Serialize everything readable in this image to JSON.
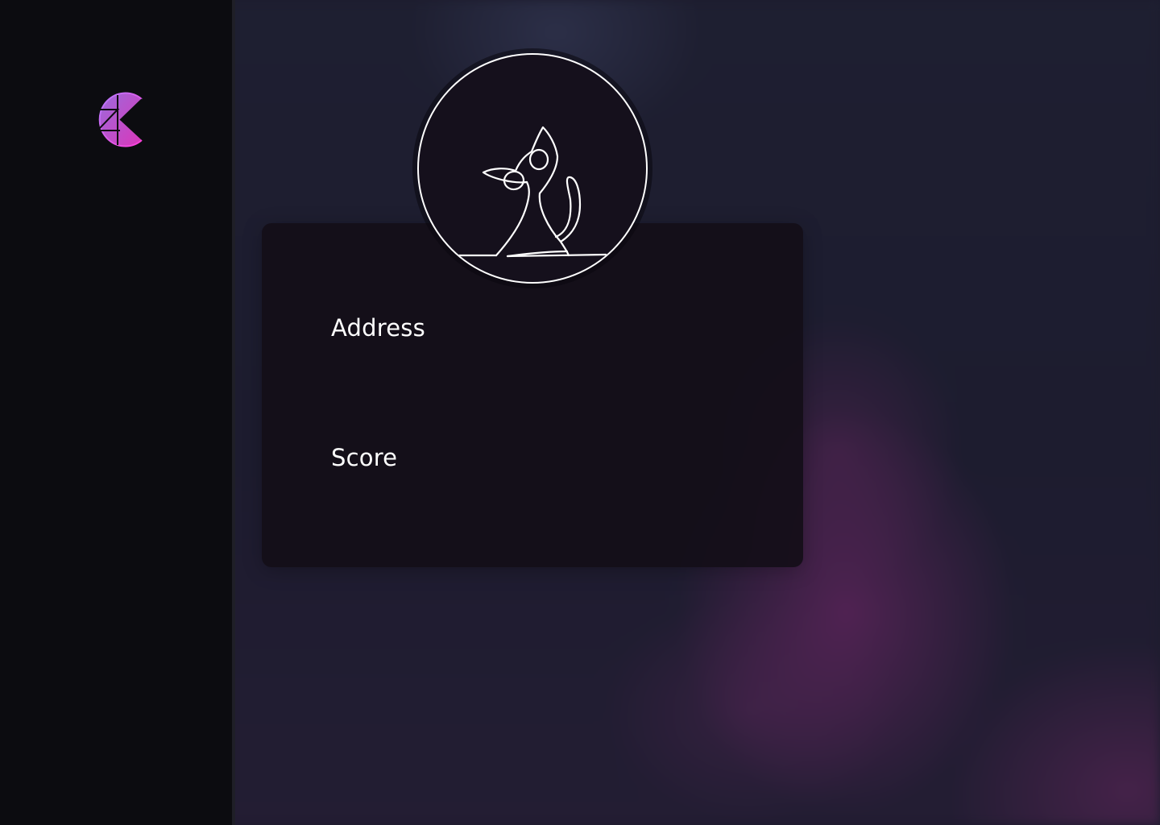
{
  "brand": {
    "logo_icon": "zk-gradient-logo-icon",
    "gradient_colors": [
      "#b47cff",
      "#ff3ed8"
    ]
  },
  "profile": {
    "avatar_icon": "cat-line-art-icon",
    "fields": {
      "address_label": "Address",
      "score_label": "Score"
    }
  },
  "colors": {
    "sidebar_bg": "#0c0c10",
    "card_bg": "#140e18",
    "text": "#ffffff"
  }
}
